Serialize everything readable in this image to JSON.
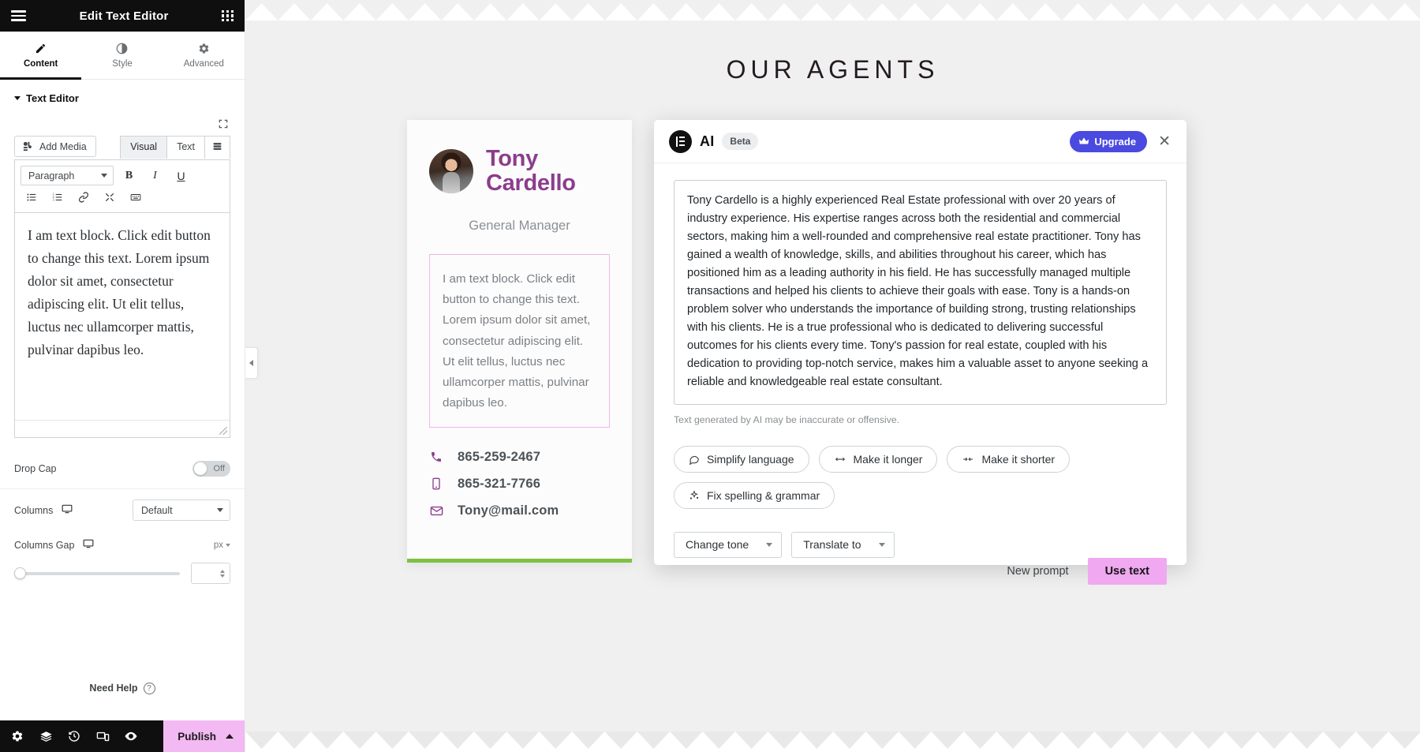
{
  "panel": {
    "title": "Edit Text Editor",
    "menu_icon": "hamburger-icon",
    "apps_icon": "grid-apps-icon",
    "tabs": [
      {
        "label": "Content",
        "icon": "pencil-icon",
        "active": true
      },
      {
        "label": "Style",
        "icon": "contrast-circle-icon",
        "active": false
      },
      {
        "label": "Advanced",
        "icon": "gear-icon",
        "active": false
      }
    ],
    "section": {
      "label": "Text Editor"
    },
    "editor": {
      "add_media": "Add Media",
      "visual_tab": "Visual",
      "text_tab": "Text",
      "format_select": "Paragraph",
      "bold": "B",
      "italic": "I",
      "underline": "U",
      "content": "I am text block. Click edit button to change this text. Lorem ipsum dolor sit amet, consectetur adipiscing elit. Ut elit tellus, luctus nec ullamcorper mattis, pulvinar dapibus leo."
    },
    "drop_cap": {
      "label": "Drop Cap",
      "state": "Off"
    },
    "columns": {
      "label": "Columns",
      "value": "Default",
      "device_icon": "desktop-icon"
    },
    "columns_gap": {
      "label": "Columns Gap",
      "unit": "px",
      "value": "",
      "device_icon": "desktop-icon"
    },
    "need_help": "Need Help",
    "footer": {
      "icons": [
        "gear-icon",
        "layers-icon",
        "history-icon",
        "responsive-icon",
        "preview-eye-icon"
      ],
      "publish": "Publish"
    }
  },
  "canvas": {
    "section_title": "OUR AGENTS",
    "agent": {
      "name_line1": "Tony",
      "name_line2": "Cardello",
      "role": "General Manager",
      "text_block": "I am text block. Click edit button to change this text. Lorem ipsum dolor sit amet, consectetur adipiscing elit. Ut elit tellus, luctus nec ullamcorper mattis, pulvinar dapibus leo.",
      "contacts": [
        {
          "icon": "phone-icon",
          "value": "865-259-2467"
        },
        {
          "icon": "mobile-icon",
          "value": "865-321-7766"
        },
        {
          "icon": "envelope-icon",
          "value": "Tony@mail.com"
        }
      ],
      "accent_color": "#8c3d8c",
      "underline_color": "#7dc242"
    }
  },
  "ai_modal": {
    "brand": "AI",
    "badge": "Beta",
    "logo_icon": "elementor-logo-icon",
    "upgrade": {
      "label": "Upgrade",
      "icon": "crown-icon",
      "color": "#4a4ae0"
    },
    "close_icon": "close-icon",
    "result_text": "Tony Cardello is a highly experienced Real Estate professional with over 20 years of industry experience. His expertise ranges across both the residential and commercial sectors, making him a well-rounded and comprehensive real estate practitioner. Tony has gained a wealth of knowledge, skills, and abilities throughout his career, which has positioned him as a leading authority in his field. He has successfully managed multiple transactions and helped his clients to achieve their goals with ease. Tony is a hands-on problem solver who understands the importance of building strong, trusting relationships with his clients. He is a true professional who is dedicated to delivering successful outcomes for his clients every time. Tony's passion for real estate, coupled with his dedication to providing top-notch service, makes him a valuable asset to anyone seeking a reliable and knowledgeable real estate consultant.",
    "disclaimer": "Text generated by AI may be inaccurate or offensive.",
    "chips": [
      {
        "label": "Simplify language",
        "icon": "speech-bubble-icon"
      },
      {
        "label": "Make it longer",
        "icon": "expand-arrows-icon"
      },
      {
        "label": "Make it shorter",
        "icon": "collapse-arrows-icon"
      },
      {
        "label": "Fix spelling & grammar",
        "icon": "sparkle-icon"
      }
    ],
    "dropdowns": [
      {
        "label": "Change tone"
      },
      {
        "label": "Translate to"
      }
    ],
    "new_prompt": "New prompt",
    "use_text": "Use text",
    "use_text_color": "#f0a8f0"
  }
}
